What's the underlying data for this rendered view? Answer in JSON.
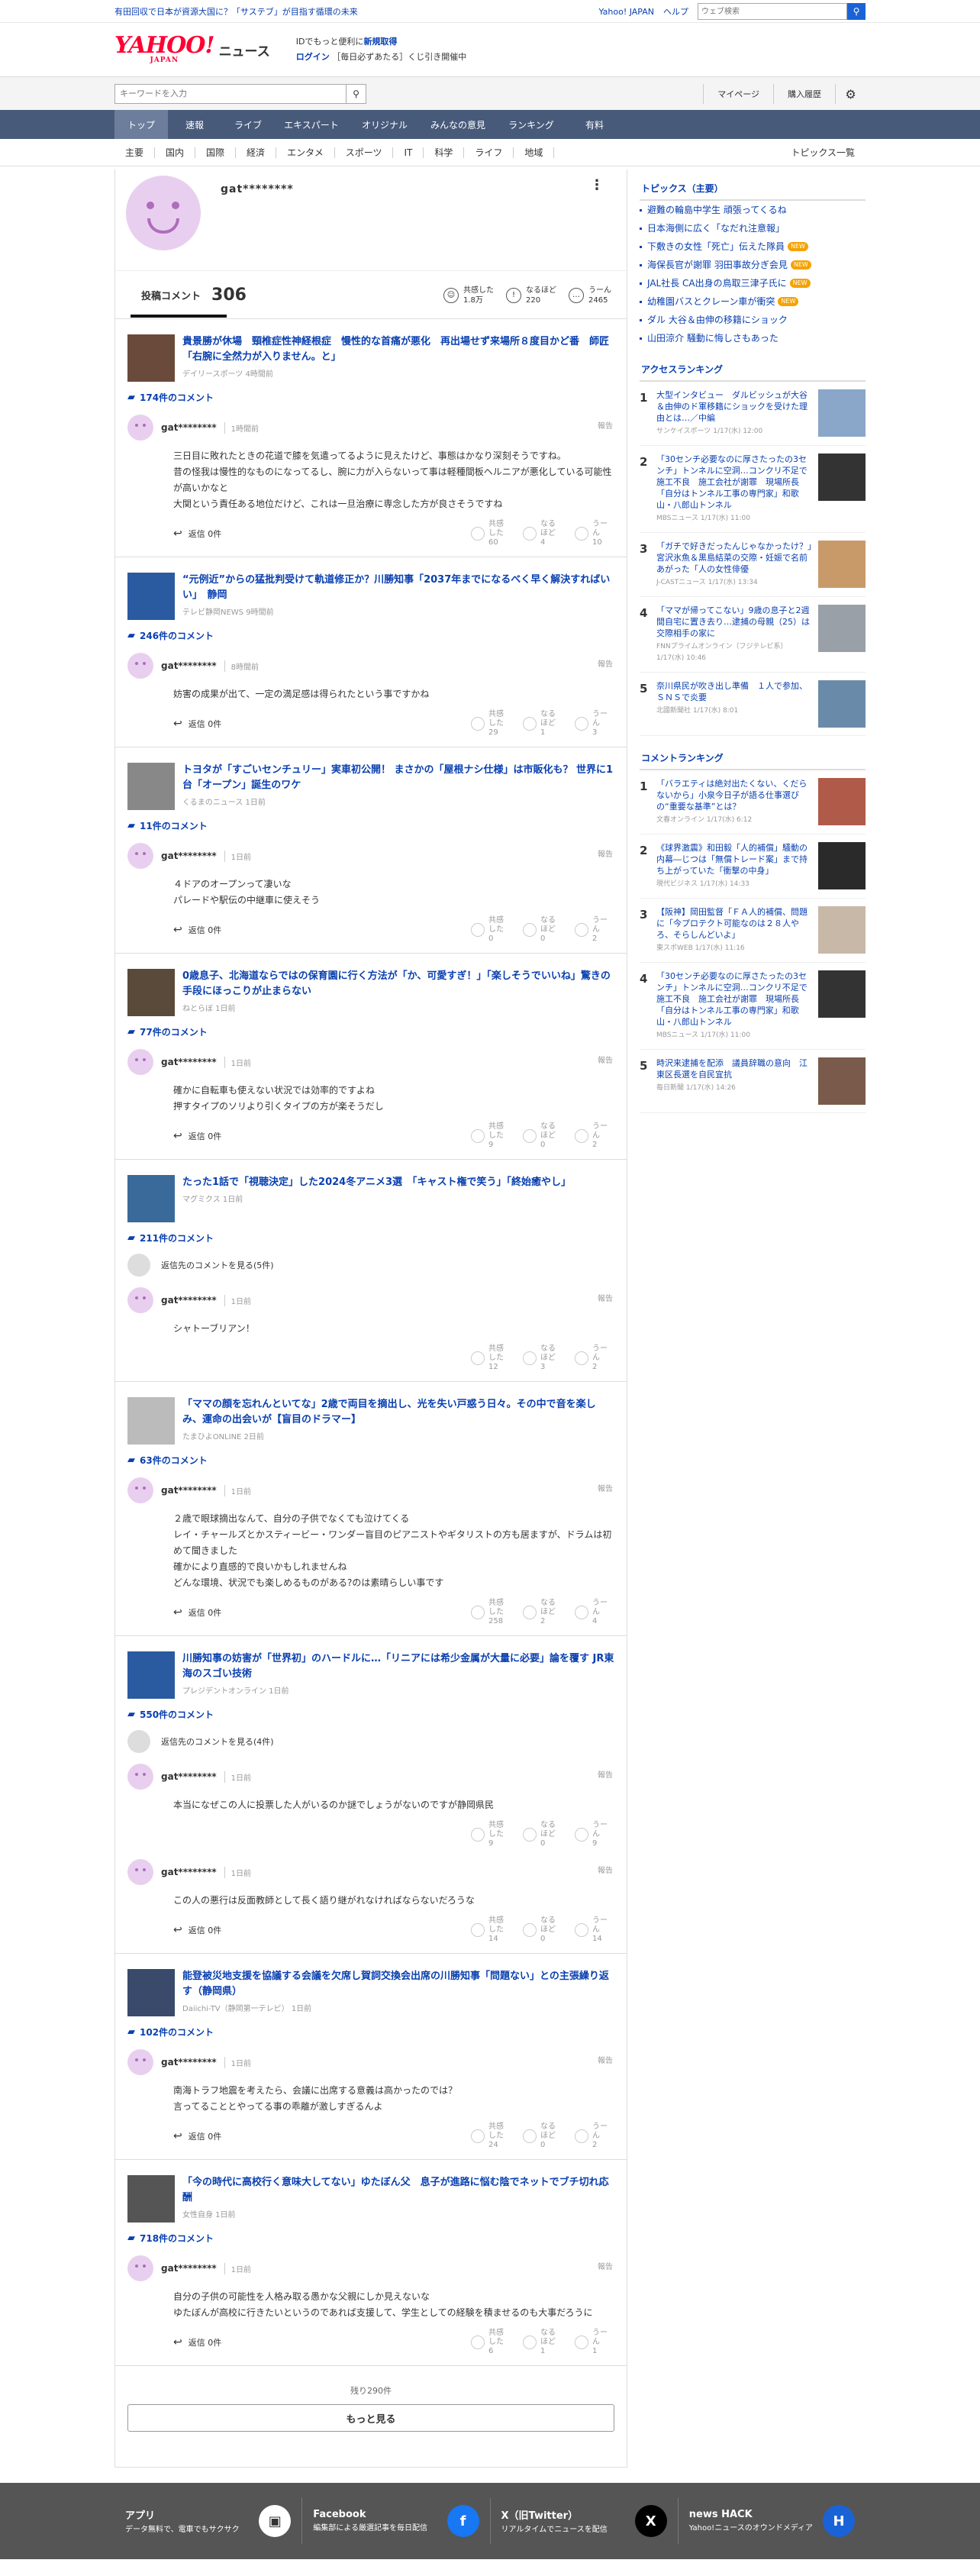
{
  "top": {
    "headline": "有田回収で日本が資源大国に？「サステブ」が目指す循環の未来",
    "yahoo_japan": "Yahoo! JAPAN",
    "help": "ヘルプ",
    "search_placeholder": "ウェブ検索"
  },
  "header": {
    "logo": "YAHOO!",
    "logo_japan": "JAPAN",
    "logo_sub": "ニュース",
    "info_line1": "IDでもっと便利に",
    "info_link": "新規取得",
    "login": "ログイン",
    "info_line2": "［毎日必ずあたる］くじ引き開催中"
  },
  "subsearch": {
    "placeholder": "キーワードを入力",
    "mypage": "マイページ",
    "history": "購入履歴"
  },
  "gnav": [
    "トップ",
    "速報",
    "ライブ",
    "エキスパート",
    "オリジナル",
    "みんなの意見",
    "ランキング",
    "有料"
  ],
  "cnav": {
    "items": [
      "主要",
      "国内",
      "国際",
      "経済",
      "エンタメ",
      "スポーツ",
      "IT",
      "科学",
      "ライフ",
      "地域"
    ],
    "all": "トピックス一覧"
  },
  "profile": {
    "name": "gat********",
    "count_label": "投稿コメント",
    "count": "306",
    "stats": [
      {
        "label": "共感した",
        "value": "1.8万"
      },
      {
        "label": "なるほど",
        "value": "220"
      },
      {
        "label": "うーん",
        "value": "2465"
      }
    ]
  },
  "articles": [
    {
      "title": "貴景勝が休場　頸椎症性神経根症　慢性的な首痛が悪化　再出場せず来場所８度目かど番　師匠「右腕に全然力が入りません。と」",
      "source": "デイリースポーツ 4時間前",
      "count": "174件のコメント",
      "thumb": "#6a4a3a",
      "comments": [
        {
          "name": "gat********",
          "time": "1時間前",
          "body": "三日目に敗れたときの花道で膝を気遣ってるように見えたけど、事態はかなり深刻そうですね。\n昔の怪我は慢性的なものになってるし、腕に力が入らないって事は軽種間板ヘルニアが悪化している可能性が高いかなと\n大関という責任ある地位だけど、これは一旦治療に専念した方が良さそうですね",
          "reply": "返信 0件",
          "r": [
            "60",
            "4",
            "10"
          ]
        }
      ]
    },
    {
      "title": "“元例近”からの猛批判受けて軌道修正か？川勝知事「2037年までになるべく早く解決すればいい」　静岡",
      "source": "テレビ静岡NEWS 9時間前",
      "count": "246件のコメント",
      "thumb": "#2a5aa0",
      "comments": [
        {
          "name": "gat********",
          "time": "8時間前",
          "body": "妨害の成果が出て、一定の満足感は得られたという事ですかね",
          "reply": "返信 0件",
          "r": [
            "29",
            "1",
            "3"
          ]
        }
      ]
    },
    {
      "title": "トヨタが「すごいセンチュリー」実車初公開！ まさかの「屋根ナシ仕様」は市販化も？ 世界に1台「オープン」誕生のワケ",
      "source": "くるまのニュース 1日前",
      "count": "11件のコメント",
      "thumb": "#888888",
      "comments": [
        {
          "name": "gat********",
          "time": "1日前",
          "body": "４ドアのオープンって凄いな\nパレードや駅伝の中継車に使えそう",
          "reply": "返信 0件",
          "r": [
            "0",
            "0",
            "2"
          ]
        }
      ]
    },
    {
      "title": "0歳息子、北海道ならではの保育園に行く方法が「か、可愛すぎ！」「楽しそうでいいね」驚きの手段にほっこりが止まらない",
      "source": "ねとらぼ 1日前",
      "count": "77件のコメント",
      "thumb": "#5a4a3a",
      "comments": [
        {
          "name": "gat********",
          "time": "1日前",
          "body": "確かに自転車も使えない状況では効率的ですよね\n押すタイプのソリより引くタイプの方が楽そうだし",
          "reply": "返信 0件",
          "r": [
            "9",
            "0",
            "2"
          ]
        }
      ]
    },
    {
      "title": "たった1話で「視聴決定」した2024冬アニメ3選　「キャスト権で笑う」「終始癒やし」",
      "source": "マグミクス 1日前",
      "count": "211件のコメント",
      "thumb": "#3a6a9a",
      "replyline": "返信先のコメントを見る(5件)",
      "comments": [
        {
          "name": "gat********",
          "time": "1日前",
          "body": "シャトーブリアン！",
          "reply": "",
          "r": [
            "12",
            "3",
            "2"
          ]
        }
      ]
    },
    {
      "title": "「ママの顔を忘れんといてな」2歳で両目を摘出し、光を失い戸惑う日々。その中で音を楽しみ、運命の出会いが【盲目のドラマー】",
      "source": "たまひよONLINE 2日前",
      "count": "63件のコメント",
      "thumb": "#bbbbbb",
      "comments": [
        {
          "name": "gat********",
          "time": "1日前",
          "body": "２歳で眼球摘出なんて、自分の子供でなくても泣けてくる\nレイ・チャールズとかスティービー・ワンダー盲目のピアニストやギタリストの方も居ますが、ドラムは初めて聞きました\n確かにより直感的で良いかもしれませんね\nどんな環境、状況でも楽しめるものがある?のは素晴らしい事です",
          "reply": "返信 0件",
          "r": [
            "258",
            "2",
            "4"
          ]
        }
      ]
    },
    {
      "title": "川勝知事の妨害が「世界初」のハードルに…「リニアには希少金属が大量に必要」論を覆す JR東海のスゴい技術",
      "source": "プレジデントオンライン 1日前",
      "count": "550件のコメント",
      "thumb": "#2a5aa0",
      "replyline": "返信先のコメントを見る(4件)",
      "comments": [
        {
          "name": "gat********",
          "time": "1日前",
          "body": "本当になぜこの人に投票した人がいるのか謎でしょうがないのですが静岡県民",
          "reply": "",
          "r": [
            "9",
            "0",
            "9"
          ]
        },
        {
          "name": "gat********",
          "time": "1日前",
          "body": "この人の悪行は反面教師として長く語り継がれなければならないだろうな",
          "reply": "返信 0件",
          "r": [
            "14",
            "0",
            "14"
          ]
        }
      ]
    },
    {
      "title": "能登被災地支援を協議する会議を欠席し賀詞交換会出席の川勝知事「問題ない」との主張繰り返す（静岡県）",
      "source": "Daiichi-TV（静岡第一テレビ） 1日前",
      "count": "102件のコメント",
      "thumb": "#3a4a6a",
      "comments": [
        {
          "name": "gat********",
          "time": "1日前",
          "body": "南海トラフ地震を考えたら、会議に出席する意義は高かったのでは？\n言ってることとやってる事の乖離が激しすぎるんよ",
          "reply": "返信 0件",
          "r": [
            "24",
            "0",
            "2"
          ]
        }
      ]
    },
    {
      "title": "「今の時代に高校行く意味大してない」ゆたぼん父　息子が進路に悩む陰でネットでブチ切れ応酬",
      "source": "女性自身 1日前",
      "count": "718件のコメント",
      "thumb": "#555555",
      "comments": [
        {
          "name": "gat********",
          "time": "1日前",
          "body": "自分の子供の可能性を人格み取る愚かな父親にしか見えないな\nゆたぼんが高校に行きたいというのであれば支援して、学生としての経験を積ませるのも大事だろうに",
          "reply": "返信 0件",
          "r": [
            "6",
            "1",
            "1"
          ]
        }
      ]
    }
  ],
  "more": {
    "remain": "残り290件",
    "button": "もっと見る"
  },
  "topics": {
    "title": "トピックス（主要）",
    "items": [
      {
        "text": "避難の輪島中学生 頑張ってくるね",
        "badge": ""
      },
      {
        "text": "日本海側に広く「なだれ注意報」",
        "badge": ""
      },
      {
        "text": "下敷きの女性「死亡」伝えた隊員",
        "badge": "NEW"
      },
      {
        "text": "海保長官が謝罪 羽田事故分ぎ会見",
        "badge": "NEW"
      },
      {
        "text": "JAL社長 CA出身の鳥取三津子氏に",
        "badge": "NEW"
      },
      {
        "text": "幼稚園バスとクレーン車が衝突",
        "badge": "NEW"
      },
      {
        "text": "ダル 大谷＆由伸の移籍にショック",
        "badge": ""
      },
      {
        "text": "山田涼介 騒動に悔しさもあった",
        "badge": ""
      }
    ]
  },
  "access_ranking": {
    "title": "アクセスランキング",
    "items": [
      {
        "text": "大型インタビュー　ダルビッシュが大谷＆由伸のド軍移籍にショックを受けた理由とは…／中編",
        "src": "サンケイスポーツ 1/17(水) 12:00",
        "color": "#8aa6c8"
      },
      {
        "text": "「30センチ必要なのに厚さたったの3センチ」トンネルに空洞…コンクリ不足で施工不良　施工会社が謝罪　現場所長「自分はトンネル工事の専門家」和歌山・八郎山トンネル",
        "src": "MBSニュース 1/17(水) 11:00",
        "color": "#333333"
      },
      {
        "text": "「ガチで好きだったんじゃなかったけ？」　宮沢氷魚＆黒島結菜の交際・妊娠で名前あがった「人の女性俳優",
        "src": "J-CASTニュース 1/17(水) 13:34",
        "color": "#c89a6a"
      },
      {
        "text": "「ママが帰ってこない」9歳の息子と2週間自宅に置き去り…逮捕の母親（25）は交際相手の家に",
        "src": "FNNプライムオンライン（フジテレビ系） 1/17(水) 10:46",
        "color": "#9aa0a8"
      },
      {
        "text": "奈川県民が吹き出し準備　１人で参加、ＳＮＳで炎要",
        "src": "北國新聞社 1/17(水) 8:01",
        "color": "#6a8aaa"
      }
    ]
  },
  "comment_ranking": {
    "title": "コメントランキング",
    "items": [
      {
        "text": "「バラエティは絶対出たくない、くだらないから」小泉今日子が語る仕事選びの“重要な基準”とは？",
        "src": "文春オンライン 1/17(水) 6:12",
        "color": "#b05a4a"
      },
      {
        "text": "《球界激震》和田毅「人的補償」騒動の内幕―じつは「無償トレード案」まで持ち上がっていた「衝撃の中身」",
        "src": "現代ビジネス 1/17(水) 14:33",
        "color": "#2a2a2a"
      },
      {
        "text": "【阪神】岡田監督「ＦＡ人的補償、問題に「今プロテクト可能なのは２８人やろ、そらしんどいよ」",
        "src": "東スポWEB 1/17(水) 11:16",
        "color": "#c8b8a8"
      },
      {
        "text": "「30センチ必要なのに厚さたったの3センチ」トンネルに空洞…コンクリ不足で施工不良　施工会社が謝罪　現場所長「自分はトンネル工事の専門家」和歌山・八郎山トンネル",
        "src": "MBSニュース 1/17(水) 11:00",
        "color": "#333333"
      },
      {
        "text": "時沢来逮捕を配添　議員辞職の意向　江東区長選を自民宜抗",
        "src": "毎日新聞 1/17(水) 14:26",
        "color": "#7a5a4a"
      }
    ]
  },
  "reaction_labels": [
    "共感した",
    "なるほど",
    "うーん"
  ],
  "report_label": "報告",
  "footer": [
    {
      "title": "アプリ",
      "desc": "データ無料で、電車でもサクサク",
      "icon": "app-icon",
      "bg": "#ffffff",
      "fg": "#333",
      "glyph": "▣"
    },
    {
      "title": "Facebook",
      "desc": "編集部による厳選記事を毎日配信",
      "icon": "facebook-icon",
      "bg": "#1877f2",
      "fg": "#fff",
      "glyph": "f"
    },
    {
      "title": "X（旧Twitter）",
      "desc": "リアルタイムでニュースを配信",
      "icon": "x-icon",
      "bg": "#000000",
      "fg": "#fff",
      "glyph": "X"
    },
    {
      "title": "news HACK",
      "desc": "Yahoo!ニュースのオウンドメディア",
      "icon": "newshack-icon",
      "bg": "#1a63d6",
      "fg": "#fff",
      "glyph": "H"
    }
  ]
}
